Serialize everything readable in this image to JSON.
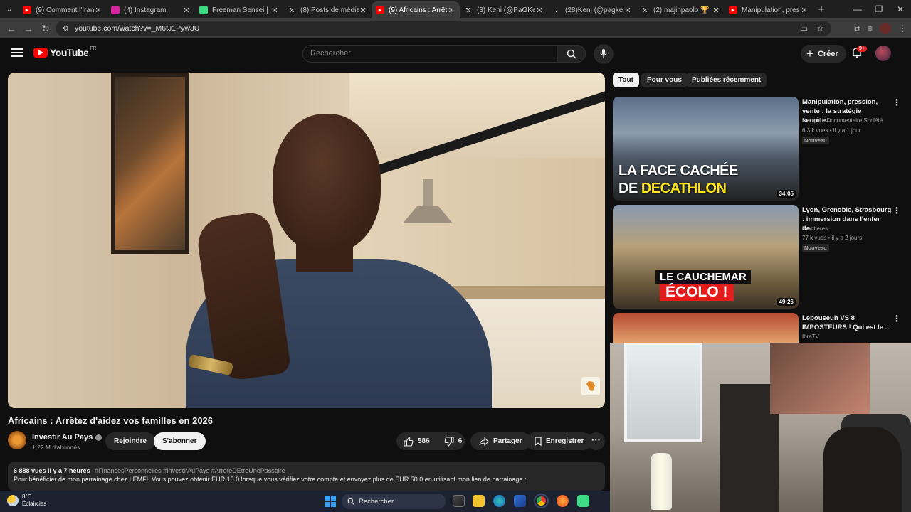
{
  "browser": {
    "tabs": [
      {
        "label": "(9) Comment l'Iran et",
        "fav": "youtube-icon",
        "color": "#ff0000"
      },
      {
        "label": "(4) Instagram",
        "fav": "instagram-icon",
        "color": "#d6249f"
      },
      {
        "label": "Freeman Sensei | Inst",
        "fav": "page-icon",
        "color": "#3ddc84"
      },
      {
        "label": "(8) Posts de médias d",
        "fav": "x-icon",
        "color": "#1f1f1f"
      },
      {
        "label": "(9) Africains : Arrêtez",
        "fav": "youtube-icon",
        "color": "#ff0000",
        "active": true
      },
      {
        "label": "(3) Keni (@PaGKeni)",
        "fav": "x-icon",
        "color": "#1f1f1f"
      },
      {
        "label": "(28)Keni (@pagkeni)",
        "fav": "tiktok-icon",
        "color": "#1f1f1f"
      },
      {
        "label": "(2) majinpaolo 🏆 (@",
        "fav": "x-icon",
        "color": "#1f1f1f"
      },
      {
        "label": "Manipulation, pressi",
        "fav": "youtube-icon",
        "color": "#ff0000"
      }
    ],
    "url": "youtube.com/watch?v=_M6tJ1Pyw3U"
  },
  "yt_header": {
    "logo_word": "YouTube",
    "logo_region": "FR",
    "search_placeholder": "Rechercher",
    "create_label": "Créer",
    "notif_badge": "9+"
  },
  "video": {
    "title": "Africains : Arrêtez d'aidez vos familles en 2026",
    "channel": "Investir Au Pays",
    "subscribers": "1,22 M d'abonnés",
    "join_label": "Rejoindre",
    "subscribe_label": "S'abonner",
    "likes": "586",
    "dislikes": "6",
    "share_label": "Partager",
    "save_label": "Enregistrer"
  },
  "description": {
    "views_age": "6 888 vues  il y a 7 heures",
    "hashtags": "#FinancesPersonnelles #InvestirAuPays #ArreteDEtreUnePassoire",
    "text": "Pour bénéficier de mon parrainage chez LEMFI: Vous pouvez obtenir EUR 15.0 lorsque vous vérifiez votre compte et envoyez plus de EUR 50.0 en utilisant mon lien de parrainage :"
  },
  "chips": [
    "Tout",
    "Pour vous",
    "Publiées récemment"
  ],
  "recommendations": [
    {
      "title": "Manipulation, pression, vente : la stratégie secrète...",
      "channel": "Marqué • Documentaire Société",
      "stats": "6,3 k vues • il y a 1 jour",
      "badge": "Nouveau",
      "duration": "34:05",
      "thumb_line1": "LA FACE CACHÉE",
      "thumb_line2a": "DE ",
      "thumb_line2b": "DECATHLON"
    },
    {
      "title": "Lyon, Grenoble, Strasbourg : immersion dans l'enfer de...",
      "channel": "Frontières",
      "stats": "77 k vues • il y a 2 jours",
      "badge": "Nouveau",
      "duration": "49:26",
      "thumb_line1": "LE CAUCHEMAR",
      "thumb_line2": "ÉCOLO !"
    },
    {
      "title": "Lebouseuh VS 8 IMPOSTEURS ! Qui est le ...",
      "channel": "IbraTV"
    }
  ],
  "taskbar": {
    "temperature": "8°C",
    "weather": "Éclaircies",
    "search_label": "Rechercher"
  }
}
